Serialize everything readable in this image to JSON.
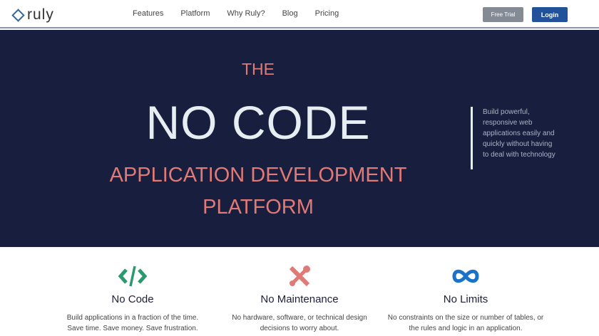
{
  "nav": {
    "brand": "ruly",
    "links": [
      "Features",
      "Platform",
      "Why Ruly?",
      "Blog",
      "Pricing"
    ],
    "free_trial": "Free Trial",
    "login": "Login"
  },
  "hero": {
    "the": "THE",
    "headline": "NO CODE",
    "sub1": "APPLICATION DEVELOPMENT",
    "sub2": "PLATFORM",
    "side_text": "Build powerful, responsive web applications easily and quickly without having to deal with technology"
  },
  "features": [
    {
      "icon": "code-icon",
      "title": "No Code",
      "l1": "Build applications in a fraction of the time.",
      "l2": "Save time. Save money. Save frustration."
    },
    {
      "icon": "tools-icon",
      "title": "No Maintenance",
      "l1": "No hardware, software, or technical design",
      "l2": "decisions to worry about."
    },
    {
      "icon": "infinity-icon",
      "title": "No Limits",
      "l1": "No constraints on the size or number of tables, or",
      "l2": "the rules and logic in an application."
    }
  ],
  "colors": {
    "navy": "#181e3e",
    "salmon": "#e07a76",
    "green": "#2a9a6e",
    "blue": "#1a73c8"
  }
}
